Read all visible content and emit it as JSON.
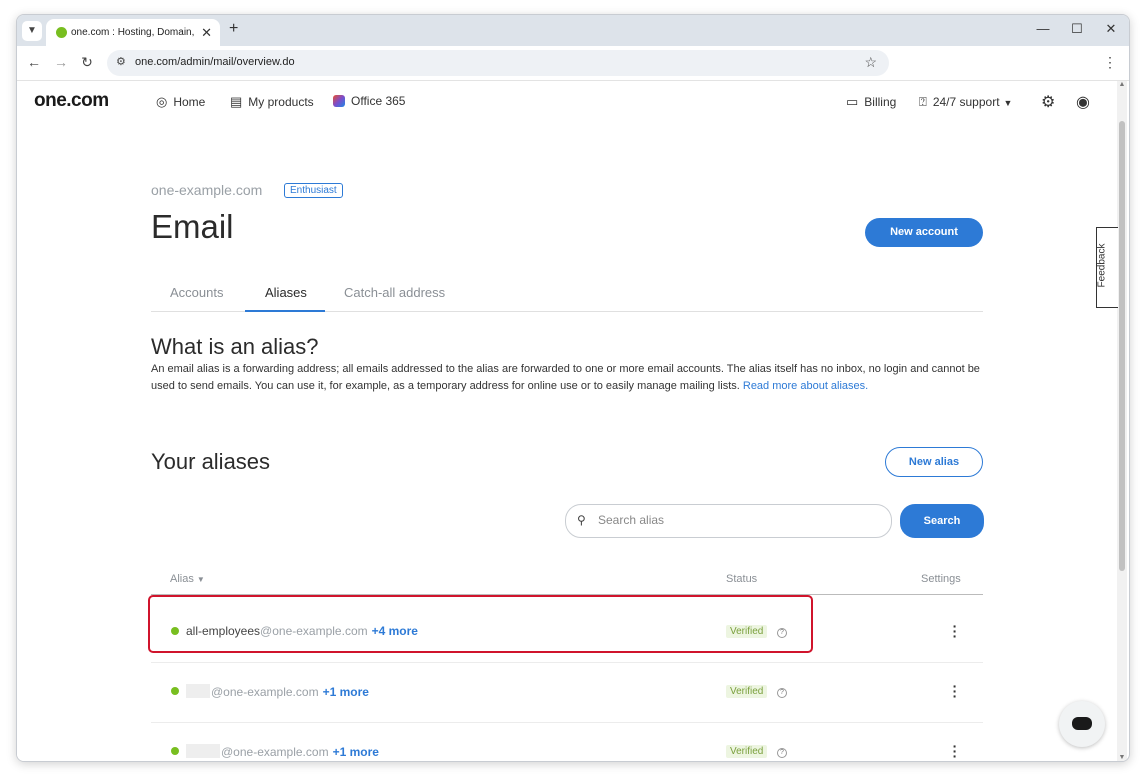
{
  "browser": {
    "tab_title": "one.com : Hosting, Domain, Em",
    "url": "one.com/admin/mail/overview.do",
    "icons": {
      "tab_menu": "chevron-down-icon",
      "tab_close": "close-icon",
      "new_tab": "plus-icon",
      "back": "arrow-left-icon",
      "forward": "arrow-right-icon",
      "reload": "reload-icon",
      "site_info": "tune-icon",
      "bookmark": "star-icon",
      "menu": "kebab-icon",
      "minimize": "minimize-icon",
      "maximize": "maximize-icon",
      "close": "close-icon"
    }
  },
  "header": {
    "logo": "one.com",
    "nav": [
      {
        "label": "Home",
        "icon": "globe-icon"
      },
      {
        "label": "My products",
        "icon": "products-icon"
      },
      {
        "label": "Office 365",
        "icon": "office365-icon"
      }
    ],
    "billing": "Billing",
    "support": "24/7 support",
    "settings_icon": "gear-icon",
    "account_icon": "user-icon"
  },
  "page": {
    "domain": "one-example.com",
    "plan_badge": "Enthusiast",
    "title": "Email",
    "new_account_button": "New account",
    "tabs": [
      "Accounts",
      "Aliases",
      "Catch-all address"
    ],
    "active_tab": "Aliases",
    "what_heading": "What is an alias?",
    "description": "An email alias is a forwarding address; all emails addressed to the alias are forwarded to one or more email accounts. The alias itself has no inbox, no login and cannot be used to send emails. You can use it, for example, as a temporary address for online use or to easily manage mailing lists. ",
    "read_more_link": "Read more about aliases.",
    "your_aliases_heading": "Your aliases",
    "new_alias_button": "New alias",
    "search": {
      "placeholder": "Search alias",
      "value": "",
      "button": "Search"
    },
    "table": {
      "headers": {
        "alias": "Alias",
        "status": "Status",
        "settings": "Settings"
      },
      "rows": [
        {
          "local": "all-employees",
          "domain": "@one-example.com",
          "more": "+4 more",
          "status": "Verified",
          "status_color": "#78be20"
        },
        {
          "local": "",
          "domain": "@one-example.com",
          "more": "+1 more",
          "status": "Verified",
          "status_color": "#78be20"
        },
        {
          "local": "",
          "domain": "@one-example.com",
          "more": "+1 more",
          "status": "Verified",
          "status_color": "#78be20"
        }
      ]
    }
  },
  "feedback_tab": "Feedback",
  "colors": {
    "accent": "#2d7ad6",
    "verified_dot": "#78be20",
    "highlight": "#d0142c"
  }
}
